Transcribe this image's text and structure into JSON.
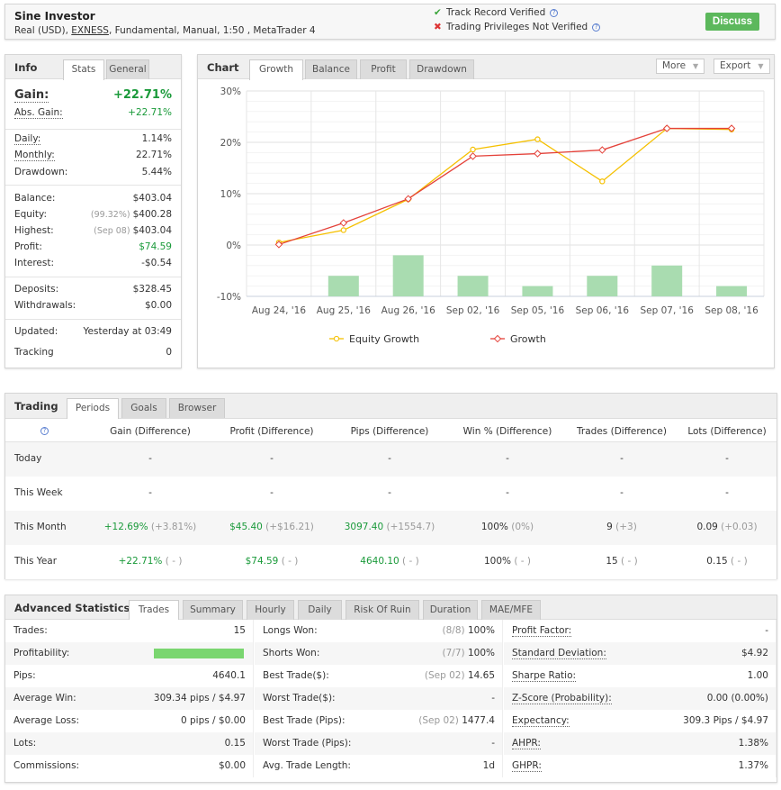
{
  "header": {
    "name": "Sine Investor",
    "sub_prefix": "Real (USD), ",
    "broker": "EXNESS",
    "sub_suffix": ", Fundamental, Manual, 1:50 , MetaTrader 4",
    "track_record": "Track Record Verified",
    "privileges": "Trading Privileges Not Verified",
    "discuss": "Discuss",
    "help_glyph": "?"
  },
  "info": {
    "title": "Info",
    "tabs": [
      "Stats",
      "General"
    ],
    "gain_label": "Gain:",
    "gain_value": "+22.71%",
    "stats": [
      {
        "label": "Abs. Gain:",
        "value": "+22.71%",
        "note": "",
        "green": true,
        "dotted": true
      },
      {
        "label": "Daily:",
        "value": "1.14%",
        "note": "",
        "dotted": true
      },
      {
        "label": "Monthly:",
        "value": "22.71%",
        "note": "",
        "dotted": true
      },
      {
        "label": "Drawdown:",
        "value": "5.44%",
        "note": ""
      },
      {
        "label": "Balance:",
        "value": "$403.04",
        "note": ""
      },
      {
        "label": "Equity:",
        "value": "$400.28",
        "note": "(99.32%) "
      },
      {
        "label": "Highest:",
        "value": "$403.04",
        "note": "(Sep 08) "
      },
      {
        "label": "Profit:",
        "value": "$74.59",
        "note": "",
        "green": true
      },
      {
        "label": "Interest:",
        "value": "-$0.54",
        "note": ""
      },
      {
        "label": "Deposits:",
        "value": "$328.45",
        "note": ""
      },
      {
        "label": "Withdrawals:",
        "value": "$0.00",
        "note": ""
      },
      {
        "label": "Updated:",
        "value": "Yesterday at 03:49",
        "note": ""
      },
      {
        "label": "Tracking",
        "value": "0",
        "note": ""
      }
    ]
  },
  "chart_panel": {
    "title": "Chart",
    "tabs": [
      "Growth",
      "Balance",
      "Profit",
      "Drawdown"
    ],
    "more": "More",
    "export": "Export"
  },
  "chart_data": {
    "type": "line",
    "categories": [
      "Aug 24, '16",
      "Aug 25, '16",
      "Aug 26, '16",
      "Sep 02, '16",
      "Sep 05, '16",
      "Sep 06, '16",
      "Sep 07, '16",
      "Sep 08, '16"
    ],
    "yticks": [
      "30%",
      "20%",
      "10%",
      "0%",
      "-10%"
    ],
    "ylim": [
      -10,
      30
    ],
    "series": [
      {
        "name": "Equity Growth",
        "color": "#f5c000",
        "values": [
          0.5,
          2.9,
          8.9,
          18.6,
          20.6,
          12.4,
          22.7,
          22.5
        ]
      },
      {
        "name": "Growth",
        "color": "#e4423a",
        "values": [
          0.1,
          4.3,
          9.0,
          17.3,
          17.8,
          18.5,
          22.71,
          22.71
        ]
      }
    ],
    "bars": {
      "color": "#a9dcb0",
      "values": [
        null,
        -6,
        -2,
        -6,
        -8,
        -6,
        -4,
        -8
      ]
    },
    "grid": true,
    "legend": "bottom"
  },
  "trading": {
    "title": "Trading",
    "tabs": [
      "Periods",
      "Goals",
      "Browser"
    ],
    "help": "?",
    "headers": [
      "Gain (Difference)",
      "Profit (Difference)",
      "Pips (Difference)",
      "Win % (Difference)",
      "Trades (Difference)",
      "Lots (Difference)"
    ],
    "rows": [
      {
        "label": "Today",
        "cells": [
          [
            "-",
            ""
          ],
          [
            "-",
            ""
          ],
          [
            "-",
            ""
          ],
          [
            "-",
            ""
          ],
          [
            "-",
            ""
          ],
          [
            "-",
            ""
          ]
        ]
      },
      {
        "label": "This Week",
        "cells": [
          [
            "-",
            ""
          ],
          [
            "-",
            ""
          ],
          [
            "-",
            ""
          ],
          [
            "-",
            ""
          ],
          [
            "-",
            ""
          ],
          [
            "-",
            ""
          ]
        ]
      },
      {
        "label": "This Month",
        "cells": [
          [
            "+12.69%",
            " (+3.81%)"
          ],
          [
            "$45.40",
            " (+$16.21)"
          ],
          [
            "3097.40",
            " (+1554.7)"
          ],
          [
            "100%",
            " (0%)"
          ],
          [
            "9",
            " (+3)"
          ],
          [
            "0.09",
            " (+0.03)"
          ]
        ]
      },
      {
        "label": "This Year",
        "cells": [
          [
            "+22.71%",
            " ( - )"
          ],
          [
            "$74.59",
            " ( - )"
          ],
          [
            "4640.10",
            " ( - )"
          ],
          [
            "100%",
            " ( - )"
          ],
          [
            "15",
            " ( - )"
          ],
          [
            "0.15",
            " ( - )"
          ]
        ]
      }
    ]
  },
  "advanced": {
    "title": "Advanced Statistics",
    "tabs": [
      "Trades",
      "Summary",
      "Hourly",
      "Daily",
      "Risk Of Ruin",
      "Duration",
      "MAE/MFE"
    ],
    "col1": [
      {
        "label": "Trades:",
        "value": "15"
      },
      {
        "label": "Profitability:",
        "value": "",
        "bar": 1.0
      },
      {
        "label": "Pips:",
        "value": "4640.1"
      },
      {
        "label": "Average Win:",
        "value": "309.34 pips / $4.97"
      },
      {
        "label": "Average Loss:",
        "value": "0 pips / $0.00"
      },
      {
        "label": "Lots:",
        "value": "0.15"
      },
      {
        "label": "Commissions:",
        "value": "$0.00"
      }
    ],
    "col2": [
      {
        "label": "Longs Won:",
        "note": "(8/8) ",
        "value": "100%"
      },
      {
        "label": "Shorts Won:",
        "note": "(7/7) ",
        "value": "100%"
      },
      {
        "label": "Best Trade($):",
        "note": "(Sep 02) ",
        "value": "14.65"
      },
      {
        "label": "Worst Trade($):",
        "note": "",
        "value": "-"
      },
      {
        "label": "Best Trade (Pips):",
        "note": "(Sep 02) ",
        "value": "1477.4"
      },
      {
        "label": "Worst Trade (Pips):",
        "note": "",
        "value": "-"
      },
      {
        "label": "Avg. Trade Length:",
        "note": "",
        "value": "1d"
      }
    ],
    "col3": [
      {
        "label": "Profit Factor:",
        "value": "-"
      },
      {
        "label": "Standard Deviation:",
        "value": "$4.92"
      },
      {
        "label": "Sharpe Ratio:",
        "value": "1.00"
      },
      {
        "label": "Z-Score (Probability):",
        "value": "0.00 (0.00%)"
      },
      {
        "label": "Expectancy:",
        "value": "309.3 Pips / $4.97"
      },
      {
        "label": "AHPR:",
        "value": "1.38%"
      },
      {
        "label": "GHPR:",
        "value": "1.37%"
      }
    ]
  }
}
